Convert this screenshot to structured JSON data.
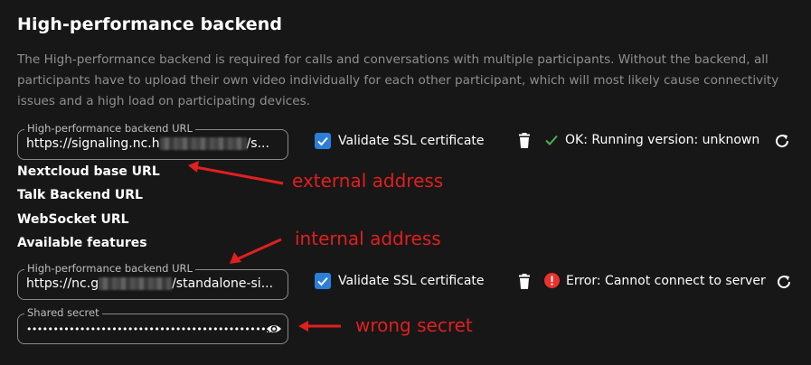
{
  "section": {
    "title": "High-performance backend",
    "description": "The High-performance backend is required for calls and conversations with multiple participants. Without the backend, all participants have to upload their own video individually for each other participant, which will most likely cause connectivity issues and a high load on participating devices."
  },
  "server1": {
    "url_label": "High-performance backend URL",
    "url_prefix": "https://signaling.nc.h",
    "url_suffix": "/s...",
    "validate_label": "Validate SSL certificate",
    "validate_checked": true,
    "status_text": "OK: Running version: unknown",
    "status_color": "#4caf50"
  },
  "info_labels": {
    "nextcloud_base_url": "Nextcloud base URL",
    "talk_backend_url": "Talk Backend URL",
    "websocket_url": "WebSocket URL",
    "available_features": "Available features"
  },
  "server2": {
    "url_label": "High-performance backend URL",
    "url_prefix": "https://nc.g",
    "url_suffix": "/standalone-si...",
    "validate_label": "Validate SSL certificate",
    "validate_checked": true,
    "status_text": "Error: Cannot connect to server",
    "status_color": "#e9322d"
  },
  "secret": {
    "label": "Shared secret",
    "value": "•••••••••••••••••••••••••••••••••••••••••••••..."
  },
  "annotations": {
    "external": "external address",
    "internal": "internal address",
    "wrong_secret": "wrong secret",
    "color": "#e11f1f"
  },
  "icons": [
    "check-icon",
    "trash-icon",
    "ok-check-icon",
    "refresh-icon",
    "error-icon",
    "eye-icon",
    "arrow-icon"
  ]
}
